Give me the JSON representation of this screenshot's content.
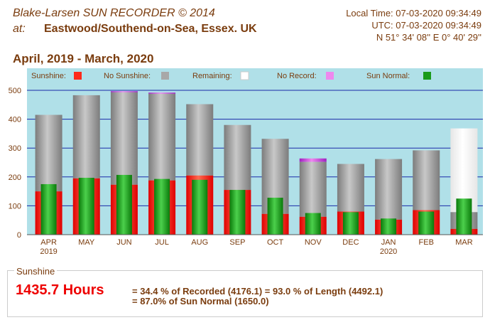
{
  "header": {
    "title": "Blake-Larsen SUN RECORDER © 2014",
    "at_label": "at:",
    "location": "Eastwood/Southend-on-Sea, Essex. UK",
    "local_time": "Local Time: 07-03-2020 09:34:49",
    "utc_time": "UTC: 07-03-2020 09:34:49",
    "coords": "N 51° 34' 08''     E 0° 40' 29''"
  },
  "period": "April, 2019   -   March, 2020",
  "colors": {
    "sunshine": "#ff2a1a",
    "no_sunshine": "#a8a8a8",
    "remaining": "#ffffff",
    "no_record": "#ee88ee",
    "sun_normal": "#1a9a1a",
    "plot_bg": "#b0e0e8",
    "grid": "#1a2aa8",
    "text": "#7a3c0e"
  },
  "chart_data": {
    "type": "bar",
    "categories": [
      "APR\n2019",
      "MAY",
      "JUN",
      "JUL",
      "AUG",
      "SEP",
      "OCT",
      "NOV",
      "DEC",
      "JAN\n2020",
      "FEB",
      "MAR"
    ],
    "ylim": [
      0,
      500
    ],
    "yticks": [
      0,
      100,
      200,
      300,
      400,
      500
    ],
    "legend": [
      {
        "name": "Sunshine:",
        "color_key": "sunshine"
      },
      {
        "name": "No Sunshine:",
        "color_key": "no_sunshine"
      },
      {
        "name": "Remaining:",
        "color_key": "remaining"
      },
      {
        "name": "No Record:",
        "color_key": "no_record"
      },
      {
        "name": "Sun Normal:",
        "color_key": "sun_normal"
      }
    ],
    "sunshine": [
      150,
      195,
      173,
      188,
      205,
      155,
      72,
      62,
      80,
      52,
      85,
      20
    ],
    "length_total": [
      415,
      483,
      497,
      492,
      452,
      380,
      332,
      264,
      245,
      262,
      292,
      368
    ],
    "recorded_total": [
      415,
      483,
      493,
      488,
      452,
      380,
      332,
      252,
      245,
      262,
      292,
      78
    ],
    "sun_normal": [
      175,
      197,
      207,
      193,
      190,
      155,
      128,
      75,
      78,
      56,
      80,
      125
    ]
  },
  "summary": {
    "label": "Sunshine",
    "hours": "1435.7 Hours",
    "line1": "= 34.4 % of Recorded (4176.1) = 93.0 % of Length (4492.1)",
    "line2": "= 87.0% of Sun Normal (1650.0)"
  }
}
